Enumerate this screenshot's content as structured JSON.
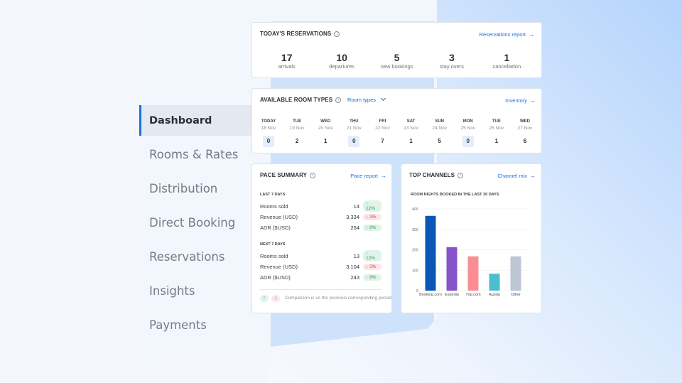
{
  "sidebar": {
    "items": [
      {
        "label": "Dashboard",
        "active": true
      },
      {
        "label": "Rooms & Rates"
      },
      {
        "label": "Distribution"
      },
      {
        "label": "Direct Booking"
      },
      {
        "label": "Reservations"
      },
      {
        "label": "Insights"
      },
      {
        "label": "Payments"
      }
    ]
  },
  "reservations": {
    "title": "TODAY'S RESERVATIONS",
    "info_icon": "i",
    "link": "Reservations report",
    "arrow": "→",
    "stats": [
      {
        "value": "17",
        "label": "arrivals"
      },
      {
        "value": "10",
        "label": "departures"
      },
      {
        "value": "5",
        "label": "new bookings"
      },
      {
        "value": "3",
        "label": "stay overs"
      },
      {
        "value": "1",
        "label": "cancellation"
      }
    ]
  },
  "room_types": {
    "title": "AVAILABLE ROOM TYPES",
    "info_icon": "i",
    "dropdown": "Room types",
    "dropdown_icon": "⌄",
    "link": "Inventory",
    "arrow": "→",
    "days": [
      {
        "day": "TODAY",
        "date": "18 Nov",
        "count": "0"
      },
      {
        "day": "TUE",
        "date": "19 Nov",
        "count": "2"
      },
      {
        "day": "WED",
        "date": "20 Nov",
        "count": "1"
      },
      {
        "day": "THU",
        "date": "21 Nov",
        "count": "0"
      },
      {
        "day": "FRI",
        "date": "22 Nov",
        "count": "7"
      },
      {
        "day": "SAT",
        "date": "23 Nov",
        "count": "1"
      },
      {
        "day": "SUN",
        "date": "24 Nov",
        "count": "5"
      },
      {
        "day": "MON",
        "date": "25 Nov",
        "count": "0"
      },
      {
        "day": "TUE",
        "date": "26 Nov",
        "count": "1"
      },
      {
        "day": "WED",
        "date": "27 Nov",
        "count": "6"
      }
    ]
  },
  "pace": {
    "title": "PACE SUMMARY",
    "info_icon": "i",
    "link": "Pace report",
    "arrow": "→",
    "last": {
      "heading": "LAST 7 DAYS",
      "rows": [
        {
          "label": "Rooms sold",
          "value": "14",
          "change": "↑ 12%",
          "dir": "up"
        },
        {
          "label": "Revenue (USD)",
          "value": "3,334",
          "change": "↓ 3%",
          "dir": "down"
        },
        {
          "label": "ADR ($USD)",
          "value": "254",
          "change": "↑ 9%",
          "dir": "up"
        }
      ]
    },
    "next": {
      "heading": "NEXT 7 DAYS",
      "rows": [
        {
          "label": "Rooms sold",
          "value": "13",
          "change": "↑ 12%",
          "dir": "up"
        },
        {
          "label": "Revenue (USD)",
          "value": "3,104",
          "change": "↓ 3%",
          "dir": "down"
        },
        {
          "label": "ADR ($USD)",
          "value": "243",
          "change": "↑ 9%",
          "dir": "up"
        }
      ]
    },
    "legend_up": "↑",
    "legend_down": "↓",
    "legend_text": "Comparison is vs the previous corresponding period"
  },
  "channels": {
    "title": "TOP CHANNELS",
    "info_icon": "i",
    "link": "Channel mix",
    "arrow": "→"
  },
  "chart_data": {
    "type": "bar",
    "title": "ROOM NIGHTS BOOKED IN THE LAST 30 DAYS",
    "categories": [
      "Booking.com",
      "Expedia",
      "Trip.com",
      "Agoda",
      "Other"
    ],
    "values": [
      366,
      213,
      168,
      83,
      168
    ],
    "colors": [
      "#0b57b8",
      "#8753c9",
      "#f98d92",
      "#4bbfcf",
      "#bdc6d4"
    ],
    "yticks": [
      0,
      100,
      200,
      300,
      400
    ],
    "ylim": [
      0,
      400
    ],
    "xlabel": "",
    "ylabel": "",
    "grid": true
  }
}
